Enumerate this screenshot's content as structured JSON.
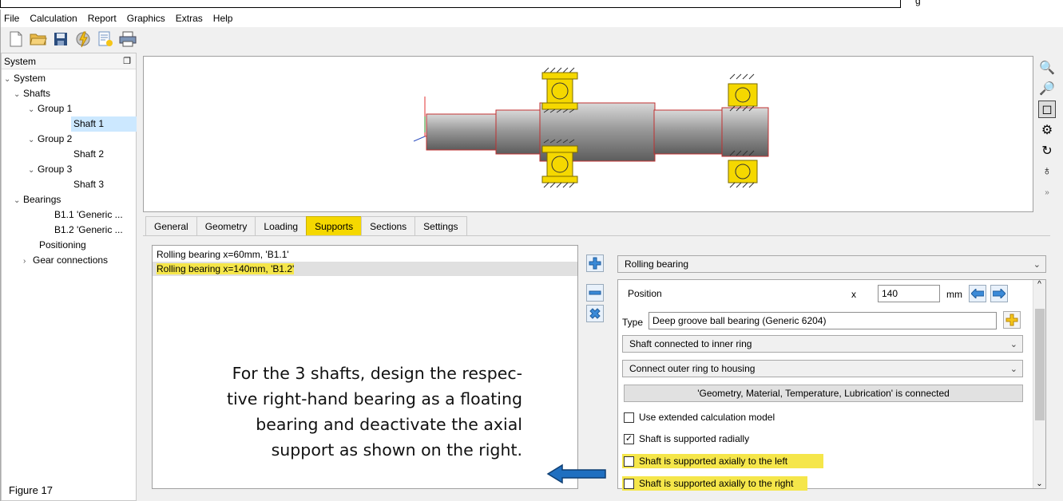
{
  "top_right_text": "g",
  "menu": [
    "File",
    "Calculation",
    "Report",
    "Graphics",
    "Extras",
    "Help"
  ],
  "toolbar_icons": [
    "new-file-icon",
    "open-folder-icon",
    "save-icon",
    "calculate-icon",
    "report-icon",
    "print-icon"
  ],
  "system_panel": {
    "title": "System",
    "tree": [
      {
        "label": "System",
        "level": 0,
        "expanded": true
      },
      {
        "label": "Shafts",
        "level": 1,
        "expanded": true
      },
      {
        "label": "Group 1",
        "level": 2,
        "expanded": true
      },
      {
        "label": "Shaft 1",
        "level": 3,
        "selected": true
      },
      {
        "label": "Group 2",
        "level": 2,
        "expanded": true
      },
      {
        "label": "Shaft 2",
        "level": 3
      },
      {
        "label": "Group 3",
        "level": 2,
        "expanded": true
      },
      {
        "label": "Shaft 3",
        "level": 3
      },
      {
        "label": "Bearings",
        "level": 1,
        "expanded": true
      },
      {
        "label": "B1.1 'Generic ...",
        "level": 2
      },
      {
        "label": "B1.2 'Generic ...",
        "level": 2
      },
      {
        "label": "Positioning",
        "level": 1
      },
      {
        "label": "Gear connections",
        "level": 1,
        "collapsed": true
      }
    ]
  },
  "tabs": [
    "General",
    "Geometry",
    "Loading",
    "Supports",
    "Sections",
    "Settings"
  ],
  "active_tab": "Supports",
  "supports_list": [
    "Rolling bearing  x=60mm, 'B1.1'",
    "Rolling bearing  x=140mm, 'B1.2'"
  ],
  "support_type": "Rolling bearing",
  "position": {
    "label": "Position",
    "axis": "x",
    "value": "140",
    "unit": "mm"
  },
  "type": {
    "label": "Type",
    "value": "Deep groove ball bearing (Generic 6204)"
  },
  "inner_ring": "Shaft connected to inner ring",
  "outer_ring": "Connect outer ring to housing",
  "connected_button": "'Geometry, Material, Temperature, Lubrication' is connected",
  "checkboxes": [
    {
      "label": "Use extended calculation model",
      "checked": false,
      "highlight": false
    },
    {
      "label": "Shaft is supported radially",
      "checked": true,
      "highlight": false
    },
    {
      "label": "Shaft is supported axially to the left",
      "checked": false,
      "highlight": true
    },
    {
      "label": "Shaft is supported axially to the right",
      "checked": false,
      "highlight": true
    }
  ],
  "annotation": [
    "For the 3 shafts, design the respec-",
    "tive right-hand bearing as a floating",
    "bearing and deactivate the axial",
    "support as shown on the right."
  ],
  "caption": "Figure 17",
  "colors": {
    "highlight": "#f5e64a",
    "tab_active": "#f5d800",
    "bearing": "#f5d800",
    "shaft": "#9a9a9a",
    "arrow": "#1f6fc0"
  }
}
